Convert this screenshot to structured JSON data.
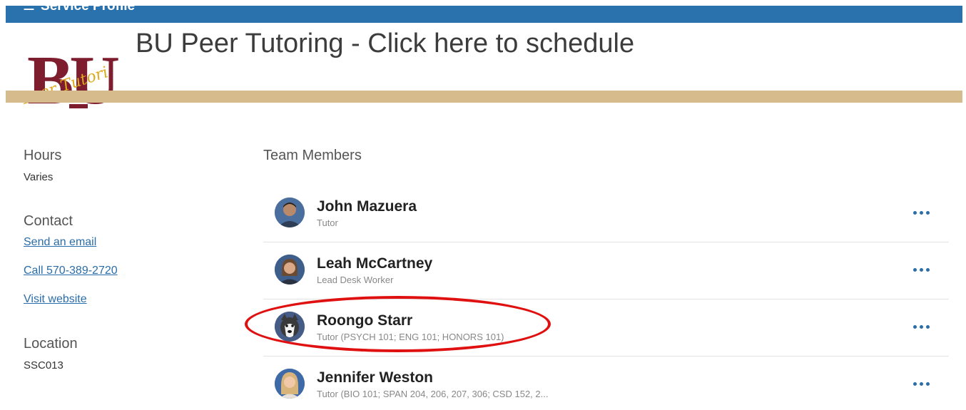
{
  "header": {
    "top_text": "Service Profile",
    "top_icon": "menu-icon",
    "title": "BU Peer Tutoring - Click here to schedule"
  },
  "logo": {
    "text_main": "BU",
    "text_script": "Peer Tutoring",
    "colors": {
      "maroon": "#7d1d2e",
      "gold": "#e0a91d"
    }
  },
  "sidebar": {
    "hours_label": "Hours",
    "hours_value": "Varies",
    "contact_label": "Contact",
    "email_link": "Send an email",
    "call_link": "Call 570-389-2720",
    "website_link": "Visit website",
    "location_label": "Location",
    "location_value": "SSC013"
  },
  "team": {
    "heading": "Team Members",
    "members": [
      {
        "name": "John Mazuera",
        "role": "Tutor",
        "avatar": "person-avatar"
      },
      {
        "name": "Leah McCartney",
        "role": "Lead Desk Worker",
        "avatar": "person-avatar"
      },
      {
        "name": "Roongo Starr",
        "role": "Tutor (PSYCH 101; ENG 101; HONORS 101)",
        "avatar": "husky-mascot-avatar"
      },
      {
        "name": "Jennifer Weston",
        "role": "Tutor (BIO 101; SPAN 204, 206, 207, 306; CSD 152, 2...",
        "avatar": "person-avatar"
      }
    ]
  },
  "colors": {
    "top_bar": "#2a72ad",
    "rule": "#d6bb8d",
    "link": "#2a6da8",
    "highlight": "#e01010"
  }
}
